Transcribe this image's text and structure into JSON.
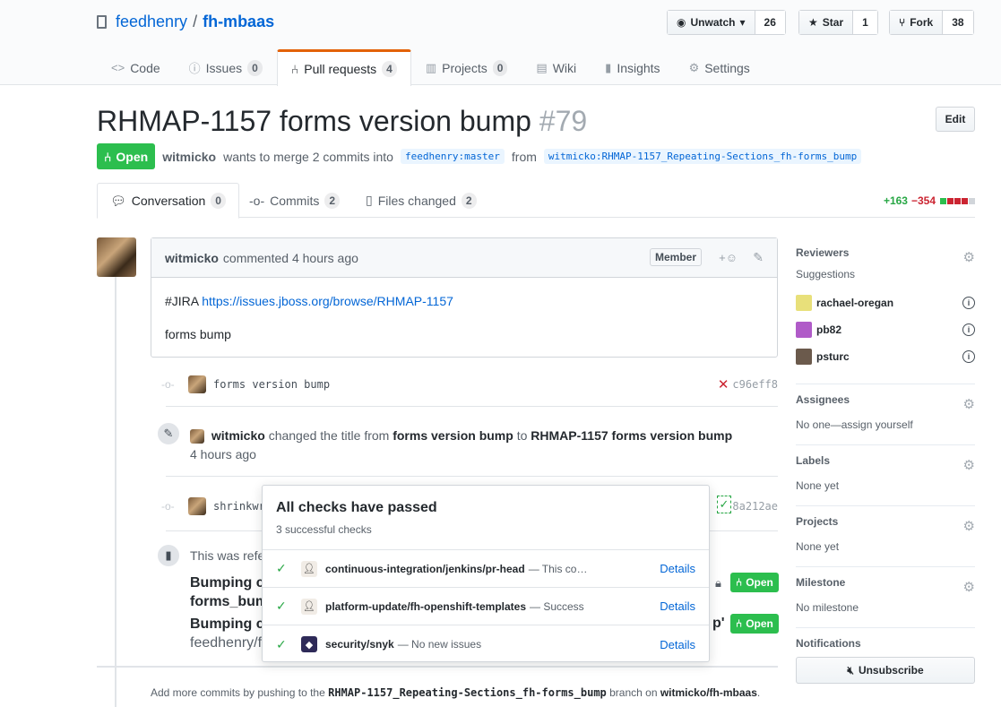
{
  "repo": {
    "owner": "feedhenry",
    "separator": "/",
    "name": "fh-mbaas"
  },
  "actions": [
    {
      "label": "Unwatch",
      "icon": "eye-icon",
      "count": "26"
    },
    {
      "label": "Star",
      "icon": "star-icon",
      "count": "1"
    },
    {
      "label": "Fork",
      "icon": "fork-icon",
      "count": "38"
    }
  ],
  "reponav": [
    {
      "label": "Code",
      "counter": ""
    },
    {
      "label": "Issues",
      "counter": "0"
    },
    {
      "label": "Pull requests",
      "counter": "4"
    },
    {
      "label": "Projects",
      "counter": "0"
    },
    {
      "label": "Wiki",
      "counter": ""
    },
    {
      "label": "Insights",
      "counter": ""
    },
    {
      "label": "Settings",
      "counter": ""
    }
  ],
  "pr": {
    "title": "RHMAP-1157 forms version bump",
    "number": "#79",
    "edit_label": "Edit",
    "state": "Open",
    "author": "witmicko",
    "merge_text": "wants to merge 2 commits into",
    "base_branch": "feedhenry:master",
    "from_text": "from",
    "head_branch": "witmicko:RHMAP-1157_Repeating-Sections_fh-forms_bump"
  },
  "tabs": [
    {
      "label": "Conversation",
      "counter": "0"
    },
    {
      "label": "Commits",
      "counter": "2"
    },
    {
      "label": "Files changed",
      "counter": "2"
    }
  ],
  "diffstat": {
    "additions": "+163",
    "deletions": "−354"
  },
  "comment": {
    "author": "witmicko",
    "time": "commented 4 hours ago",
    "member_label": "Member",
    "reaction": "+☺",
    "jira_prefix": "#JIRA",
    "jira_link": "https://issues.jboss.org/browse/RHMAP-1157",
    "body_line2": "forms bump"
  },
  "commit1": {
    "message": "forms version bump",
    "sha": "c96eff8"
  },
  "rename_event": {
    "author": "witmicko",
    "text1": "changed the title from",
    "old_title": "forms version bump",
    "text2": "to",
    "new_title": "RHMAP-1157 forms version bump",
    "time": "4 hours ago"
  },
  "commit2": {
    "message": "shrinkwr",
    "sha": "8a212ae"
  },
  "reference": {
    "text": "This was refe",
    "title1a": "Bumping c",
    "title1b": "forms_bum",
    "title2": "Bumping c",
    "title2_tail": "p'",
    "sub": "feedhenry/fh",
    "state": "Open"
  },
  "checks": {
    "title": "All checks have passed",
    "subtitle": "3 successful checks",
    "details_label": "Details",
    "items": [
      {
        "name": "continuous-integration/jenkins/pr-head",
        "desc": "— This co…",
        "icon": "jenkins-icon"
      },
      {
        "name": "platform-update/fh-openshift-templates",
        "desc": "— Success",
        "icon": "jenkins-icon"
      },
      {
        "name": "security/snyk",
        "desc": "— No new issues",
        "icon": "snyk-icon"
      }
    ]
  },
  "push_note": {
    "prefix": "Add more commits by pushing to the",
    "branch": "RHMAP-1157_Repeating-Sections_fh-forms_bump",
    "middle": "branch on",
    "repo": "witmicko/fh-mbaas",
    "suffix": "."
  },
  "sidebar": {
    "reviewers": {
      "title": "Reviewers",
      "suggestions_label": "Suggestions",
      "users": [
        {
          "name": "rachael-oregan",
          "color": "#e8e07a"
        },
        {
          "name": "pb82",
          "color": "#b05bc8"
        },
        {
          "name": "psturc",
          "color": "#6b5a4c"
        }
      ]
    },
    "assignees": {
      "title": "Assignees",
      "value": "No one—assign yourself"
    },
    "labels": {
      "title": "Labels",
      "value": "None yet"
    },
    "projects": {
      "title": "Projects",
      "value": "None yet"
    },
    "milestone": {
      "title": "Milestone",
      "value": "No milestone"
    },
    "notifications": {
      "title": "Notifications",
      "button": "Unsubscribe"
    }
  },
  "colors": {
    "open_green": "#2cbe4e",
    "link_blue": "#0366d6",
    "nav_accent": "#e36209",
    "fail_red": "#cb2431"
  }
}
